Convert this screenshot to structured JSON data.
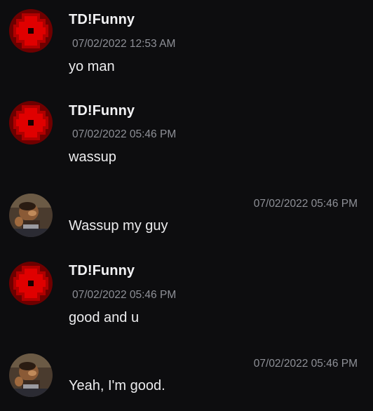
{
  "messages": [
    {
      "author": "TD!Funny",
      "timestamp": "07/02/2022 12:53 AM",
      "text": "yo man",
      "avatar": "red-pixel-avatar",
      "self": false
    },
    {
      "author": "TD!Funny",
      "timestamp": "07/02/2022 05:46 PM",
      "text": "wassup",
      "avatar": "red-pixel-avatar",
      "self": false
    },
    {
      "author": "",
      "timestamp": "07/02/2022 05:46 PM",
      "text": "Wassup my guy",
      "avatar": "character-avatar",
      "self": true
    },
    {
      "author": "TD!Funny",
      "timestamp": "07/02/2022 05:46 PM",
      "text": "good and u",
      "avatar": "red-pixel-avatar",
      "self": false
    },
    {
      "author": "",
      "timestamp": "07/02/2022 05:46 PM",
      "text": "Yeah, I'm good.",
      "avatar": "character-avatar",
      "self": true
    }
  ],
  "colors": {
    "background": "#0d0d0f",
    "text": "#ececee",
    "muted": "#8e9097",
    "avatar_red": "#d90000",
    "avatar_dark_red": "#7a0000"
  }
}
